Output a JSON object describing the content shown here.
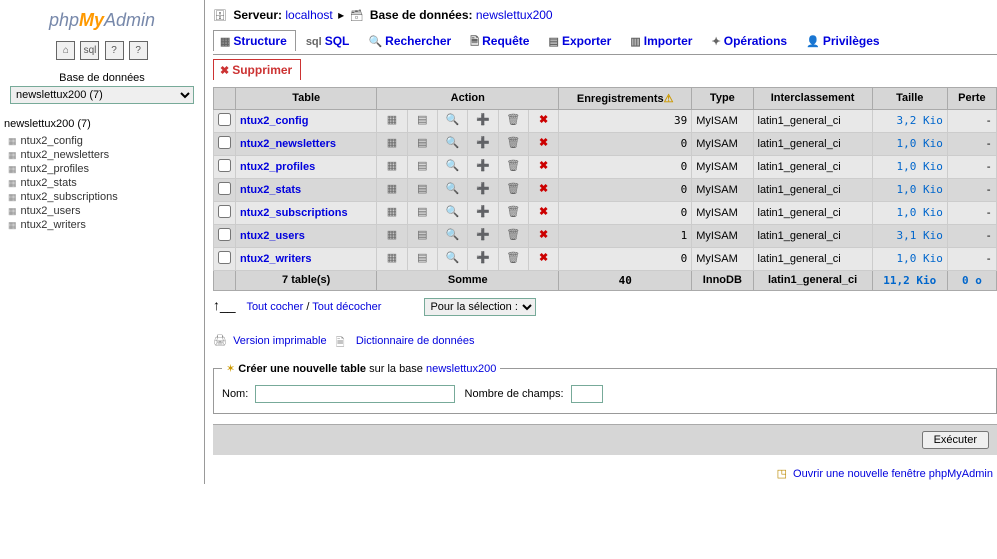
{
  "logo": {
    "p1": "php",
    "p2": "My",
    "p3": "Admin"
  },
  "sidebar": {
    "db_label": "Base de données",
    "db_select_value": "newslettux200 (7)",
    "db_tree_label": "newslettux200 (7)",
    "tables": [
      "ntux2_config",
      "ntux2_newsletters",
      "ntux2_profiles",
      "ntux2_stats",
      "ntux2_subscriptions",
      "ntux2_users",
      "ntux2_writers"
    ]
  },
  "crumb": {
    "server_label": "Serveur:",
    "server_value": "localhost",
    "db_label": "Base de données:",
    "db_value": "newslettux200"
  },
  "tabs": {
    "structure": "Structure",
    "sql": "SQL",
    "search": "Rechercher",
    "query": "Requête",
    "export": "Exporter",
    "import": "Importer",
    "ops": "Opérations",
    "privs": "Privilèges",
    "drop": "Supprimer"
  },
  "headers": {
    "table": "Table",
    "action": "Action",
    "rows": "Enregistrements",
    "type": "Type",
    "collation": "Interclassement",
    "size": "Taille",
    "overhead": "Perte"
  },
  "rows": [
    {
      "name": "ntux2_config",
      "records": "39",
      "type": "MyISAM",
      "collation": "latin1_general_ci",
      "size": "3,2 Kio",
      "overhead": "-"
    },
    {
      "name": "ntux2_newsletters",
      "records": "0",
      "type": "MyISAM",
      "collation": "latin1_general_ci",
      "size": "1,0 Kio",
      "overhead": "-"
    },
    {
      "name": "ntux2_profiles",
      "records": "0",
      "type": "MyISAM",
      "collation": "latin1_general_ci",
      "size": "1,0 Kio",
      "overhead": "-"
    },
    {
      "name": "ntux2_stats",
      "records": "0",
      "type": "MyISAM",
      "collation": "latin1_general_ci",
      "size": "1,0 Kio",
      "overhead": "-"
    },
    {
      "name": "ntux2_subscriptions",
      "records": "0",
      "type": "MyISAM",
      "collation": "latin1_general_ci",
      "size": "1,0 Kio",
      "overhead": "-"
    },
    {
      "name": "ntux2_users",
      "records": "1",
      "type": "MyISAM",
      "collation": "latin1_general_ci",
      "size": "3,1 Kio",
      "overhead": "-"
    },
    {
      "name": "ntux2_writers",
      "records": "0",
      "type": "MyISAM",
      "collation": "latin1_general_ci",
      "size": "1,0 Kio",
      "overhead": "-"
    }
  ],
  "sum": {
    "label": "7 table(s)",
    "action": "Somme",
    "records": "40",
    "type": "InnoDB",
    "collation": "latin1_general_ci",
    "size": "11,2 Kio",
    "overhead": "0 o"
  },
  "selrow": {
    "check_all": "Tout cocher",
    "uncheck_all": "Tout décocher",
    "select_label": "Pour la sélection :"
  },
  "links": {
    "print": "Version imprimable",
    "dict": "Dictionnaire de données"
  },
  "create": {
    "legend_b": "Créer une nouvelle table",
    "legend_txt": "sur la base",
    "legend_db": "newslettux200",
    "name_label": "Nom:",
    "fields_label": "Nombre de champs:",
    "exec": "Exécuter"
  },
  "newwin": "Ouvrir une nouvelle fenêtre phpMyAdmin"
}
